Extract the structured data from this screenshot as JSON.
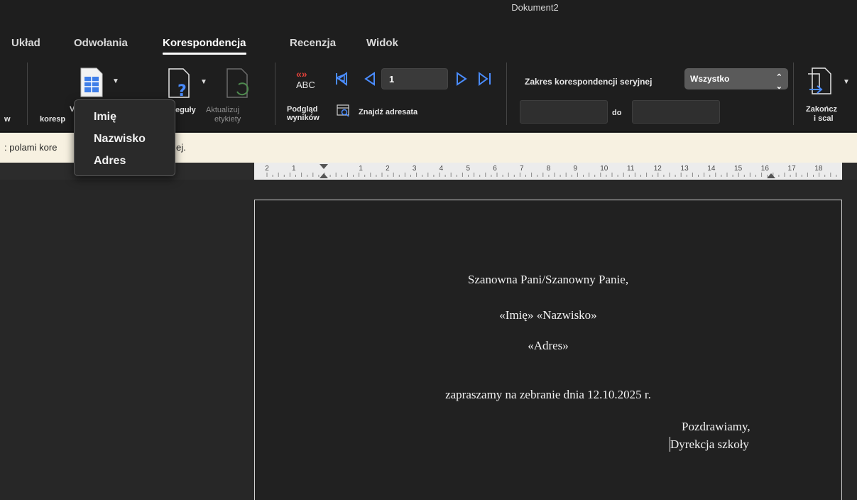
{
  "window": {
    "title": "Dokument2"
  },
  "tabs": [
    {
      "label": "Układ"
    },
    {
      "label": "Odwołania"
    },
    {
      "label": "Korespondencja"
    },
    {
      "label": "Recenzja"
    },
    {
      "label": "Widok"
    }
  ],
  "ribbon": {
    "left_cut_label": "w",
    "insert_field_label_1": "V",
    "insert_field_label_2": "koresp",
    "rules_label": "eguły",
    "update_labels_1": "Aktualizuj",
    "update_labels_2": "etykiety",
    "preview_label_1": "Podgląd",
    "preview_label_2": "wyników",
    "preview_icon_text": "ABC",
    "preview_icon_marks": "«»",
    "find_recipient_label": "Znajdź adresata",
    "record_value": "1",
    "range_label": "Zakres korespondencji seryjnej",
    "range_value": "Wszystko",
    "range_from": "",
    "range_to_label": "do",
    "range_to": "",
    "finish_label_1": "Zakończ",
    "finish_label_2": "i scal"
  },
  "infobar": {
    "text_left": ": polami kore",
    "text_right": "ej."
  },
  "ruler": {
    "labels": [
      "2",
      "1",
      "1",
      "2",
      "3",
      "4",
      "5",
      "6",
      "7",
      "8",
      "9",
      "10",
      "11",
      "12",
      "13",
      "14",
      "15",
      "16",
      "17",
      "18"
    ]
  },
  "dropdown": {
    "items": [
      "Imię",
      "Nazwisko",
      "Adres"
    ]
  },
  "document": {
    "greeting": "Szanowna Pani/Szanowny Panie,",
    "field_line": "«Imię»  «Nazwisko»",
    "address_line": "«Adres»",
    "body_line": "zapraszamy na zebranie dnia 12.10.2025 r.",
    "closing": "Pozdrawiamy,",
    "signature": "Dyrekcja szkoły"
  },
  "colors": {
    "accent_blue": "#4a8cff",
    "preview_red": "#e0413a",
    "infobar_bg": "#f7f1e1"
  }
}
